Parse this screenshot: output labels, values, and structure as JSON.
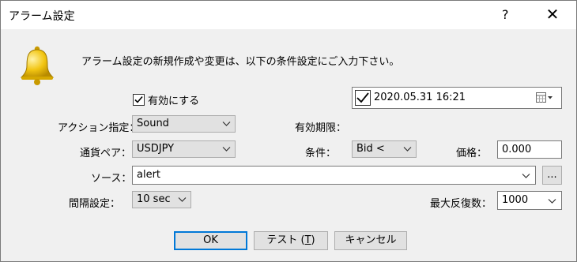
{
  "window": {
    "title": "アラーム設定",
    "help": "?",
    "close": "✕"
  },
  "description": "アラーム設定の新規作成や変更は、以下の条件設定にご入力下さい。",
  "enabled": {
    "label": "有効にする",
    "checked": true
  },
  "form": {
    "action_label": "アクション指定：",
    "action_value": "Sound",
    "expiry_label": "有効期限：",
    "expiry_value": "2020.05.31 16:21",
    "pair_label": "通貨ペア：",
    "pair_value": "USDJPY",
    "condition_label": "条件：",
    "condition_value": "Bid <",
    "price_label": "価格：",
    "price_value": "0.000",
    "source_label": "ソース：",
    "source_value": "alert",
    "browse_label": "...",
    "interval_label": "間隔設定：",
    "interval_value": "10 sec",
    "max_label": "最大反復数：",
    "max_value": "1000"
  },
  "buttons": {
    "ok": "OK",
    "test_prefix": "テスト (",
    "test_key": "T",
    "test_suffix": ")",
    "cancel": "キャンセル"
  },
  "colors": {
    "accent": "#0078d7",
    "face": "#f0f0f0",
    "button": "#e1e1e1"
  },
  "icons": [
    "bell-icon",
    "checkmark-icon",
    "chevron-down-icon",
    "calendar-icon"
  ]
}
